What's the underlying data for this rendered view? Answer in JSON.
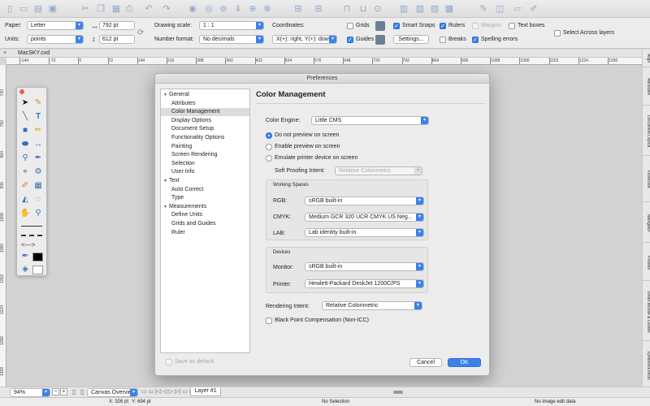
{
  "toolbar": {
    "icons": [
      "new-doc",
      "open",
      "save-as",
      "save",
      "scissors",
      "copy",
      "paste",
      "print",
      "undo",
      "redo",
      "layers",
      "layers-down",
      "layers-up",
      "download",
      "group",
      "ungroup",
      "grid",
      "grid2",
      "lock",
      "unlock",
      "hide",
      "align",
      "distribute",
      "transform",
      "fit",
      "text",
      "shapes",
      "effects"
    ]
  },
  "options": {
    "paper_label": "Paper:",
    "paper_value": "Letter",
    "units_label": "Units:",
    "units_value": "points",
    "width_value": "792 pt",
    "height_value": "612 pt",
    "drawing_scale_label": "Drawing scale:",
    "drawing_scale_value": "1 : 1",
    "number_format_label": "Number format:",
    "number_format_value": "No decimals",
    "coordinates_label": "Coordinates:",
    "coordinates_value": "X(+): right, Y(+): down",
    "grids_label": "Grids",
    "guides_label": "Guides",
    "smart_snaps_label": "Smart Snaps",
    "settings_label": "Settings...",
    "rulers_label": "Rulers",
    "breaks_label": "Breaks",
    "margins_label": "Margins",
    "spelling_label": "Spelling errors",
    "textboxes_label": "Text boxes",
    "select_across_label": "Select Across layers"
  },
  "document": {
    "tab_name": "MacSKY.cvd"
  },
  "rulers": {
    "h_numbers": [
      "-144",
      "-72",
      "0",
      "72",
      "144",
      "216",
      "288",
      "360",
      "432",
      "504",
      "576",
      "648",
      "720",
      "792",
      "864",
      "936",
      "1008",
      "1080",
      "1152",
      "1224",
      "1296"
    ],
    "v_numbers": [
      "720",
      "792",
      "864",
      "936",
      "1008",
      "1080",
      "1152",
      "1224",
      "1296",
      "1368"
    ]
  },
  "right_tabs": [
    "Align",
    "Attributes",
    "Document Layout",
    "Flowchart",
    "Navigator",
    "Presets",
    "Smart Mouse & Guides",
    "Symbols/Effects"
  ],
  "dialog": {
    "title": "Preferences",
    "tree": [
      {
        "label": "General",
        "group": true
      },
      {
        "label": "Attributes"
      },
      {
        "label": "Color Management",
        "selected": true
      },
      {
        "label": "Display Options"
      },
      {
        "label": "Document Setup"
      },
      {
        "label": "Functionality Options"
      },
      {
        "label": "Painting"
      },
      {
        "label": "Screen Rendering"
      },
      {
        "label": "Selection"
      },
      {
        "label": "User Info"
      },
      {
        "label": "Text",
        "group": true
      },
      {
        "label": "Auto Correct"
      },
      {
        "label": "Type"
      },
      {
        "label": "Measurements",
        "group": true
      },
      {
        "label": "Define Units"
      },
      {
        "label": "Grids and Guides"
      },
      {
        "label": "Ruler"
      }
    ],
    "panel_title": "Color Management",
    "color_engine_label": "Color Engine:",
    "color_engine_value": "Little CMS",
    "radio_no_preview": "Do not preview on screen",
    "radio_enable_preview": "Enable preview on screen",
    "radio_emulate": "Emulate printer device on screen",
    "soft_proofing_label": "Soft Proofing Intent:",
    "soft_proofing_value": "Relative Colorimetric",
    "working_spaces_label": "Working Spaces",
    "rgb_label": "RGB:",
    "rgb_value": "sRGB built-in",
    "cmyk_label": "CMYK:",
    "cmyk_value": "Medium GCR 320 UCR CMYK US Neg...",
    "lab_label": "LAB:",
    "lab_value": "Lab identity built-in",
    "devices_label": "Devices",
    "monitor_label": "Monitor:",
    "monitor_value": "sRGB built-in",
    "printer_label": "Printer:",
    "printer_value": "Hewlett-Packard DeskJet 1200C/PS",
    "rendering_intent_label": "Rendering Intent:",
    "rendering_intent_value": "Relative Colorimetric",
    "black_point_label": "Black Point Compensation (Non-ICC)",
    "save_default_label": "Save as default",
    "cancel_label": "Cancel",
    "ok_label": "OK"
  },
  "bottom": {
    "zoom_value": "94%",
    "view_value": "Canvas Overview",
    "layer_tab": "Layer #1"
  },
  "status": {
    "x": "X: 326 pt",
    "y": "Y: 694 pt",
    "selection": "No Selection",
    "image": "No image edit data"
  },
  "colors": {
    "accent": "#3b82e8",
    "toolbar_icon": "#8fa9c9"
  }
}
